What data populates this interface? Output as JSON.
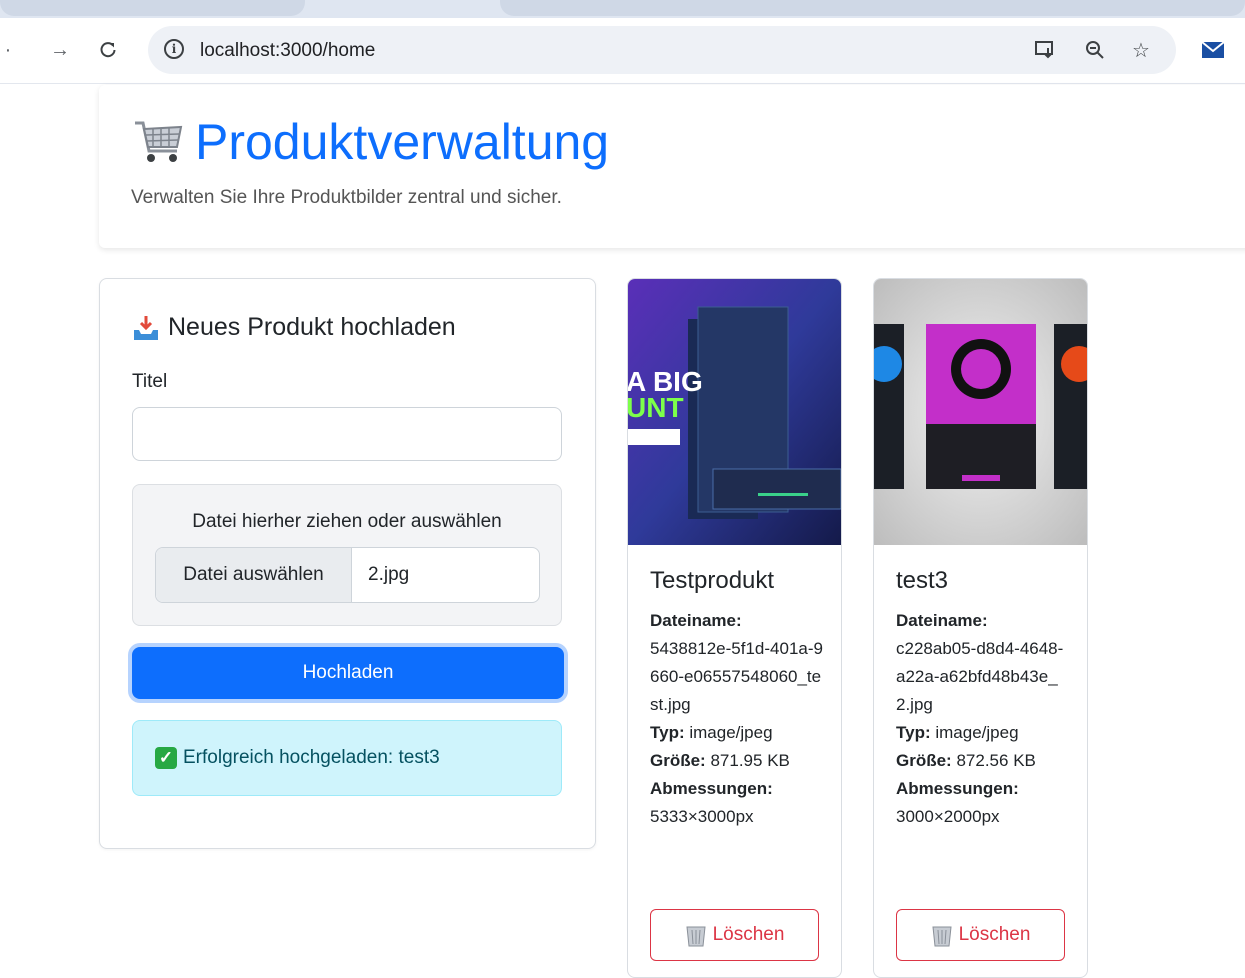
{
  "browser": {
    "url": "localhost:3000/home",
    "icons": [
      "back-arrow-icon",
      "forward-arrow-icon",
      "reload-icon",
      "info-icon",
      "install-app-icon",
      "zoom-icon",
      "bookmark-star-icon",
      "mail-extension-icon"
    ]
  },
  "header": {
    "icon": "shopping-cart-icon",
    "title": "Produktverwaltung",
    "subtitle": "Verwalten Sie Ihre Produktbilder zentral und sicher."
  },
  "upload": {
    "heading_icon": "inbox-tray-icon",
    "heading": "Neues Produkt hochladen",
    "title_label": "Titel",
    "title_value": "",
    "dropzone_text": "Datei hierher ziehen oder auswählen",
    "file_button": "Datei auswählen",
    "file_name": "2.jpg",
    "submit_label": "Hochladen",
    "success_message": "Erfolgreich hochgeladen: test3"
  },
  "labels": {
    "filename": "Dateiname:",
    "type": "Typ:",
    "size": "Größe:",
    "dimensions": "Abmessungen:",
    "delete": "Löschen"
  },
  "products": [
    {
      "title": "Testprodukt",
      "filename": "5438812e-5f1d-401a-9660-e06557548060_test.jpg",
      "type": "image/jpeg",
      "size": "871.95 KB",
      "dimensions": "5333×3000px",
      "image_overlay_line1": "A BIG",
      "image_overlay_line2": "UNT"
    },
    {
      "title": "test3",
      "filename": "c228ab05-d8d4-4648-a22a-a62bfd48b43e_2.jpg",
      "type": "image/jpeg",
      "size": "872.56 KB",
      "dimensions": "3000×2000px"
    }
  ],
  "colors": {
    "primary": "#0d6efd",
    "danger": "#dc3545",
    "info_bg": "#cff4fc",
    "info_text": "#055160"
  }
}
